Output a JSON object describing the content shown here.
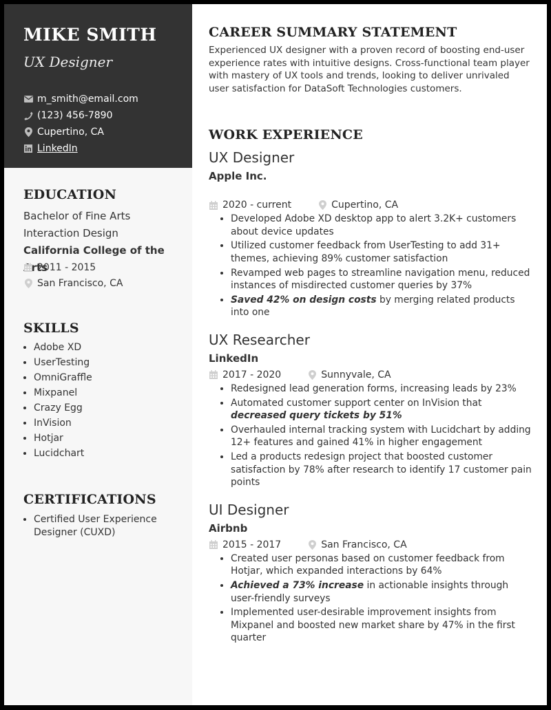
{
  "header": {
    "name": "MIKE SMITH",
    "title": "UX Designer",
    "contacts": {
      "email": {
        "icon": "envelope-icon",
        "text": "m_smith@email.com"
      },
      "phone": {
        "icon": "phone-icon",
        "text": "(123) 456-7890"
      },
      "location": {
        "icon": "map-pin-icon",
        "text": "Cupertino, CA"
      },
      "linkedin": {
        "icon": "linkedin-icon",
        "text": "LinkedIn"
      }
    }
  },
  "education": {
    "heading": "EDUCATION",
    "degree": "Bachelor of Fine Arts",
    "major": "Interaction Design",
    "school": "California College of the Arts",
    "dates": "2011 - 2015",
    "location": "San Francisco, CA"
  },
  "skills": {
    "heading": "SKILLS",
    "items": [
      "Adobe XD",
      "UserTesting",
      "OmniGraffle",
      "Mixpanel",
      "Crazy Egg",
      "InVision",
      "Hotjar",
      "Lucidchart"
    ]
  },
  "certifications": {
    "heading": "CERTIFICATIONS",
    "items": [
      "Certified User Experience Designer (CUXD)"
    ]
  },
  "summary": {
    "heading": "CAREER SUMMARY STATEMENT",
    "text": "Experienced UX designer with a proven record of boosting end-user experience rates with intuitive designs. Cross-functional team player with mastery of UX tools and trends, looking to deliver unrivaled user satisfaction for DataSoft Technologies customers."
  },
  "experience": {
    "heading": "WORK EXPERIENCE",
    "jobs": [
      {
        "title": "UX Designer",
        "company": "Apple Inc.",
        "dates": "2020 - current",
        "location": "Cupertino, CA",
        "bullets": [
          {
            "bold": "",
            "text": "Developed Adobe XD desktop app to alert 3.2K+ customers about device updates"
          },
          {
            "bold": "",
            "text": "Utilized customer feedback from UserTesting to add 31+ themes, achieving 89% customer satisfaction"
          },
          {
            "bold": "",
            "text": "Revamped web pages to streamline navigation menu, reduced instances of misdirected customer queries by 37%"
          },
          {
            "bold": "Saved 42% on design costs",
            "text": " by merging related products into one"
          }
        ]
      },
      {
        "title": "UX Researcher",
        "company": "LinkedIn",
        "dates": "2017 - 2020",
        "location": "Sunnyvale, CA",
        "bullets": [
          {
            "pre": "Redesigned lead generation forms, increasing leads by 23%",
            "bold": ""
          },
          {
            "pre": "Automated customer support center on InVision that ",
            "bold": "decreased query tickets by 51%"
          },
          {
            "pre": "Overhauled internal tracking system with Lucidchart by adding 12+ features and gained 41% in higher engagement",
            "bold": ""
          },
          {
            "pre": "Led a products redesign project that boosted customer satisfaction by 78% after research to identify 17 customer pain points",
            "bold": ""
          }
        ]
      },
      {
        "title": "UI Designer",
        "company": "Airbnb",
        "dates": "2015 - 2017",
        "location": "San Francisco, CA",
        "bullets": [
          {
            "bold": "",
            "text": "Created user personas based on customer feedback from Hotjar, which expanded interactions by 64%"
          },
          {
            "bold": "Achieved a 73% increase",
            "text": " in actionable insights through user-friendly surveys"
          },
          {
            "bold": "",
            "text": "Implemented user-desirable improvement insights from Mixpanel and boosted new market share by 47% in the first quarter"
          }
        ]
      }
    ]
  }
}
